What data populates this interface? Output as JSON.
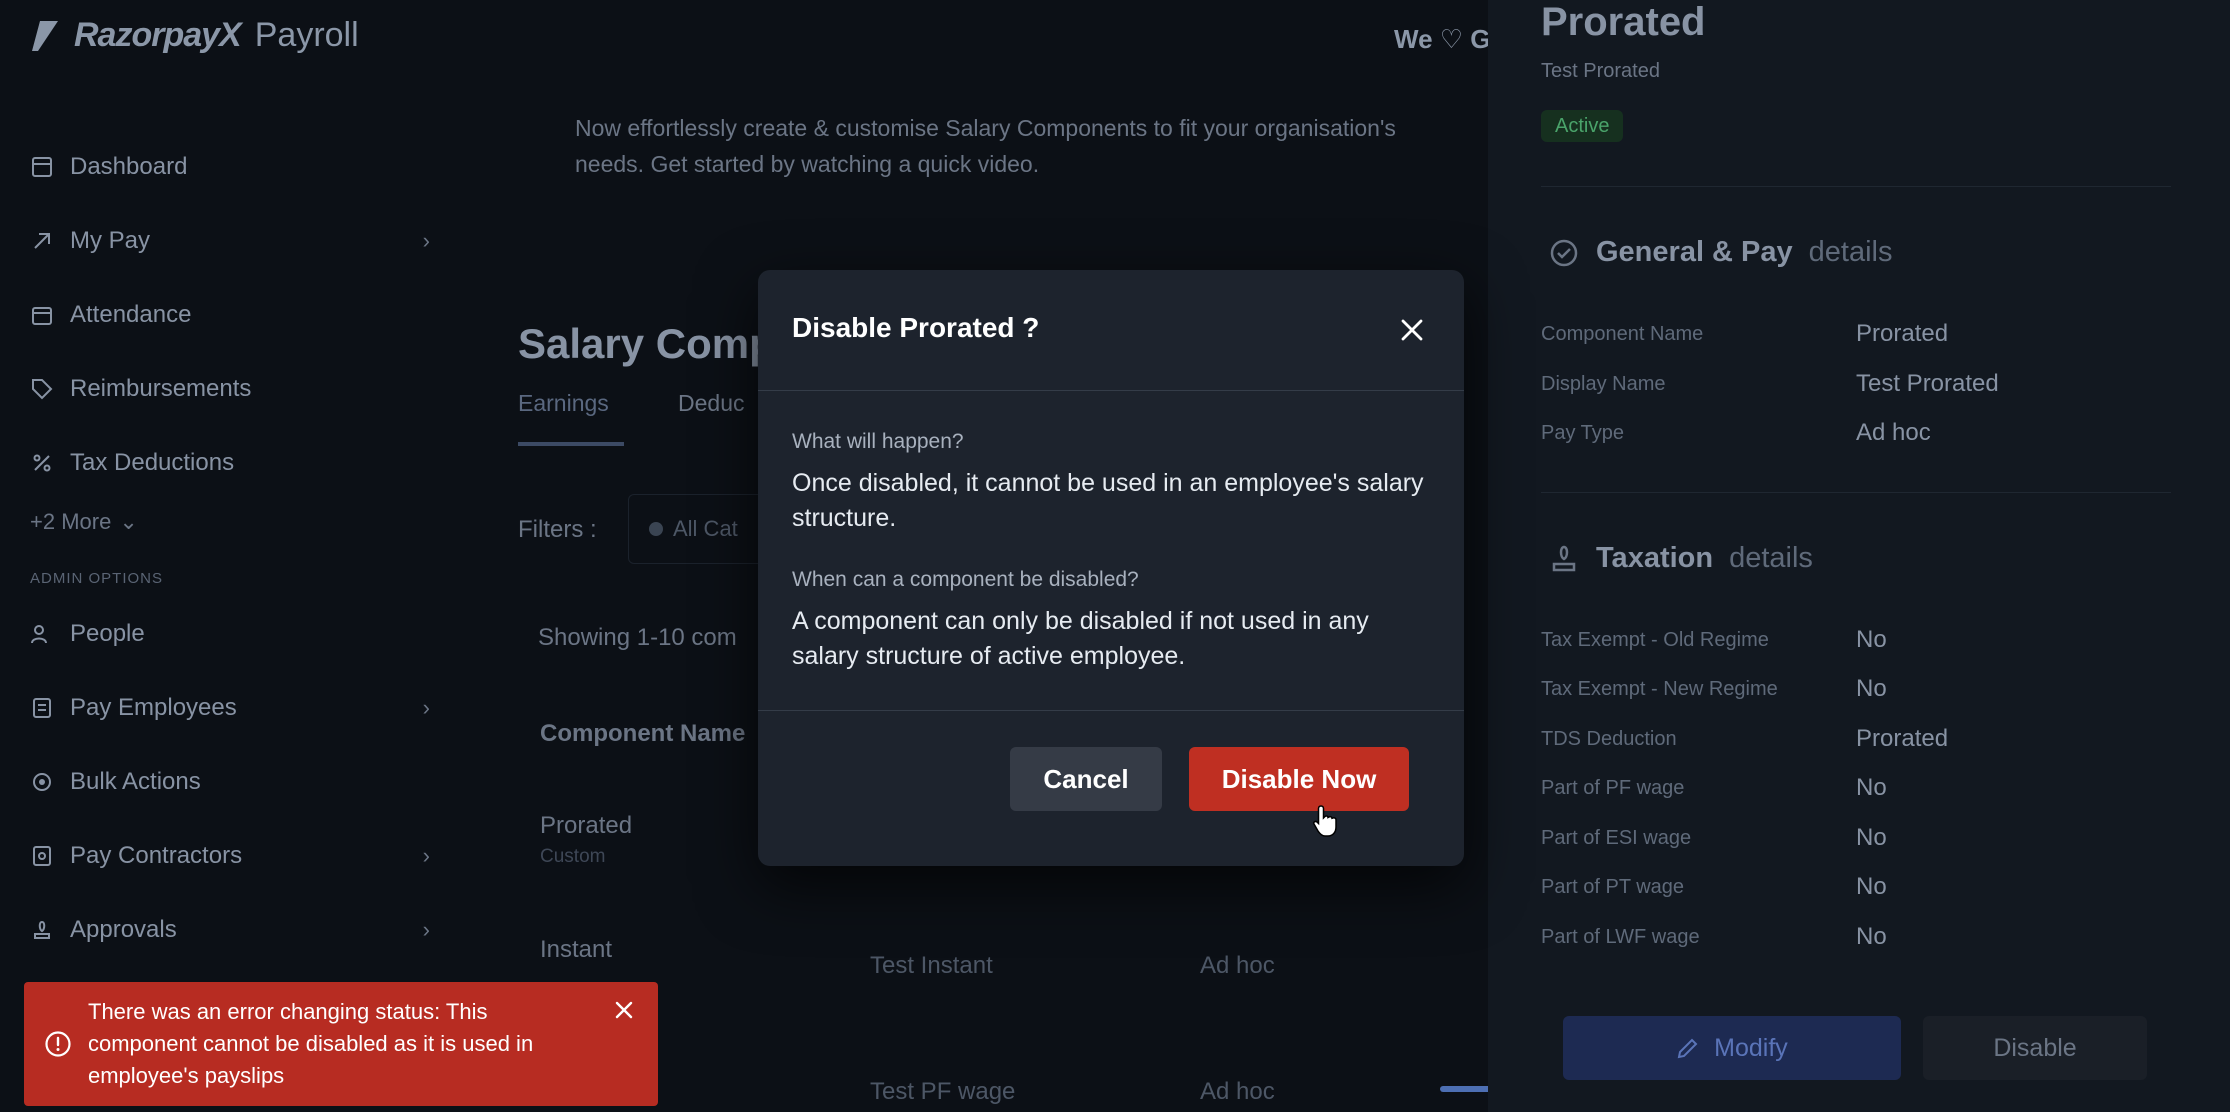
{
  "app": {
    "brand": "RazorpayX",
    "product": "Payroll",
    "love_text": "We ♡ G"
  },
  "sidebar": {
    "items": [
      {
        "label": "Dashboard",
        "icon": "dashboard-icon"
      },
      {
        "label": "My Pay",
        "icon": "arrow-up-right-icon",
        "chevron": true
      },
      {
        "label": "Attendance",
        "icon": "calendar-icon"
      },
      {
        "label": "Reimbursements",
        "icon": "tag-icon"
      },
      {
        "label": "Tax Deductions",
        "icon": "percent-icon"
      }
    ],
    "more_label": "+2 More",
    "admin_label": "ADMIN OPTIONS",
    "admin_items": [
      {
        "label": "People",
        "icon": "people-icon"
      },
      {
        "label": "Pay Employees",
        "icon": "pay-employees-icon",
        "chevron": true
      },
      {
        "label": "Bulk Actions",
        "icon": "bulk-actions-icon"
      },
      {
        "label": "Pay Contractors",
        "icon": "pay-contractors-icon",
        "chevron": true
      },
      {
        "label": "Approvals",
        "icon": "approvals-icon",
        "chevron": true
      }
    ]
  },
  "main": {
    "banner_line1": "Now effortlessly create & customise Salary Components to fit your organisation's",
    "banner_line2": "needs. Get started by watching a quick video.",
    "title": "Salary Comp",
    "tabs": [
      {
        "label": "Earnings"
      },
      {
        "label": "Deduc"
      }
    ],
    "filters_label": "Filters :",
    "filter_chip": "All Cat",
    "showing": "Showing 1-10 com",
    "table_head": "Component Name",
    "rows": [
      {
        "name": "Prorated",
        "sub": "Custom",
        "display": "",
        "pay": ""
      },
      {
        "name": "Instant",
        "sub": "",
        "display": "Test Instant",
        "pay": "Ad hoc"
      },
      {
        "name": "",
        "sub": "",
        "display": "Test PF wage",
        "pay": "Ad hoc"
      }
    ]
  },
  "drawer": {
    "title": "Prorated",
    "subtitle": "Test Prorated",
    "status": "Active",
    "general_section": {
      "title": "General & Pay",
      "suffix": "details"
    },
    "general": [
      {
        "label": "Component Name",
        "value": "Prorated"
      },
      {
        "label": "Display Name",
        "value": "Test Prorated"
      },
      {
        "label": "Pay Type",
        "value": "Ad hoc"
      }
    ],
    "tax_section": {
      "title": "Taxation",
      "suffix": "details"
    },
    "taxation": [
      {
        "label": "Tax Exempt - Old Regime",
        "value": "No"
      },
      {
        "label": "Tax Exempt - New Regime",
        "value": "No"
      },
      {
        "label": "TDS Deduction",
        "value": "Prorated"
      },
      {
        "label": "Part of PF wage",
        "value": "No"
      },
      {
        "label": "Part of ESI wage",
        "value": "No"
      },
      {
        "label": "Part of PT wage",
        "value": "No"
      },
      {
        "label": "Part of LWF wage",
        "value": "No"
      }
    ],
    "modify_label": "Modify",
    "disable_label": "Disable"
  },
  "modal": {
    "title": "Disable Prorated ?",
    "q1": "What will happen?",
    "a1": "Once disabled, it cannot be used in an employee's salary structure.",
    "q2": "When can a component be disabled?",
    "a2": "A component can only be disabled if not used in any salary structure of active employee.",
    "cancel_label": "Cancel",
    "confirm_label": "Disable Now"
  },
  "toast": {
    "message": "There was an error changing status: This component cannot be disabled as it is used in employee's payslips"
  },
  "colors": {
    "danger": "#bf2f22",
    "toast": "#b72c22",
    "modal_bg": "#1d232d",
    "success": "#4aa36a",
    "primary": "#1d2a52"
  }
}
